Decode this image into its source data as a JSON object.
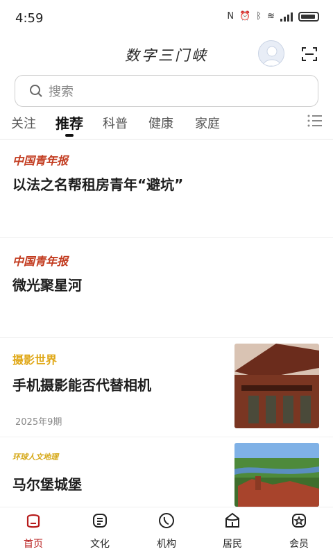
{
  "status": {
    "time": "4:59"
  },
  "app": {
    "title": "数字三门峡"
  },
  "search": {
    "placeholder": "搜索"
  },
  "tabs": [
    {
      "label": "关注"
    },
    {
      "label": "推荐"
    },
    {
      "label": "科普"
    },
    {
      "label": "健康"
    },
    {
      "label": "家庭"
    }
  ],
  "feed": [
    {
      "source": "中国青年报",
      "title": "以法之名帮租房青年“避坑”"
    },
    {
      "source": "中国青年报",
      "title": "微光聚星河"
    },
    {
      "source": "摄影世界",
      "title": "手机摄影能否代替相机",
      "meta": "2025年9期"
    },
    {
      "source": "环球人文地理",
      "title": "马尔堡城堡"
    }
  ],
  "nav": [
    {
      "label": "首页"
    },
    {
      "label": "文化"
    },
    {
      "label": "机构"
    },
    {
      "label": "居民"
    },
    {
      "label": "会员"
    }
  ],
  "colors": {
    "accent": "#b71c1c",
    "source_red": "#c23a1e",
    "source_gold": "#e0a818"
  }
}
